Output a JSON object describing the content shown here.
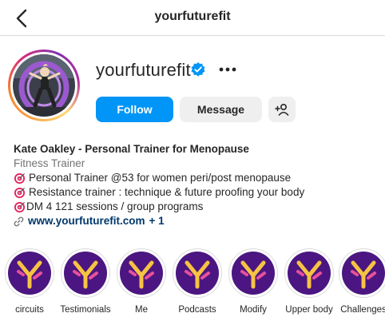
{
  "header": {
    "title": "yourfuturefit"
  },
  "profile": {
    "username": "yourfuturefit",
    "verified": true,
    "follow_label": "Follow",
    "message_label": "Message"
  },
  "bio": {
    "name": "Kate Oakley - Personal Trainer for Menopause",
    "category": "Fitness Trainer",
    "lines": [
      "Personal Trainer @53 for women peri/post menopause",
      "Resistance trainer : technique & future proofing your body",
      "DM 4 121 sessions / group programs"
    ],
    "link": "www.yourfuturefit.com",
    "link_more": "+ 1"
  },
  "highlights": [
    {
      "label": "circuits"
    },
    {
      "label": "Testimonials"
    },
    {
      "label": "Me"
    },
    {
      "label": "Podcasts"
    },
    {
      "label": "Modify"
    },
    {
      "label": "Upper body"
    },
    {
      "label": "Challenges"
    }
  ],
  "colors": {
    "accent": "#0095f6",
    "link": "#00376b",
    "highlight_bg": "#4b1681",
    "highlight_logo_yellow": "#f6c343",
    "highlight_logo_pink": "#e8509b",
    "verified": "#0095f6"
  },
  "icons": {
    "back": "chevron-left-icon",
    "verified": "verified-badge-icon",
    "more": "more-horizontal-icon",
    "add_user": "add-user-icon",
    "bio_bullet": "target-emoji-icon",
    "link": "link-icon"
  }
}
